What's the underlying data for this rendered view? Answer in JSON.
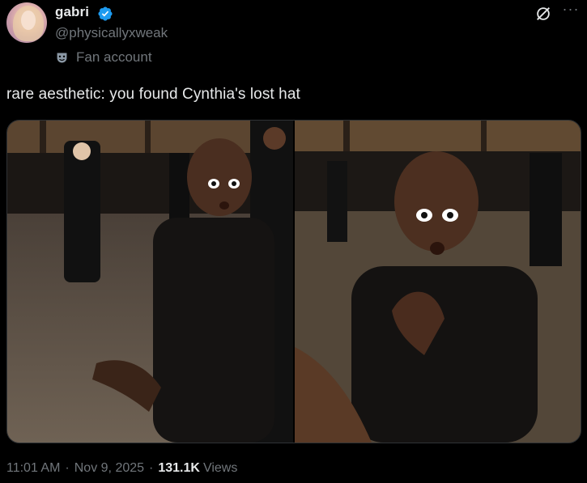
{
  "author": {
    "display_name": "gabri",
    "handle": "@physicallyxweak",
    "label": "Fan account",
    "verified_color": "#1d9bf0"
  },
  "icons": {
    "verified": "verified-badge-icon",
    "fan": "theater-mask-icon",
    "grok": "grok-icon",
    "more": "more-icon"
  },
  "tweet": {
    "text": "rare aesthetic: you found Cynthia's lost hat"
  },
  "media": {
    "count": 2
  },
  "meta": {
    "time": "11:01 AM",
    "date": "Nov 9, 2025",
    "views_count": "131.1K",
    "views_label": "Views"
  }
}
